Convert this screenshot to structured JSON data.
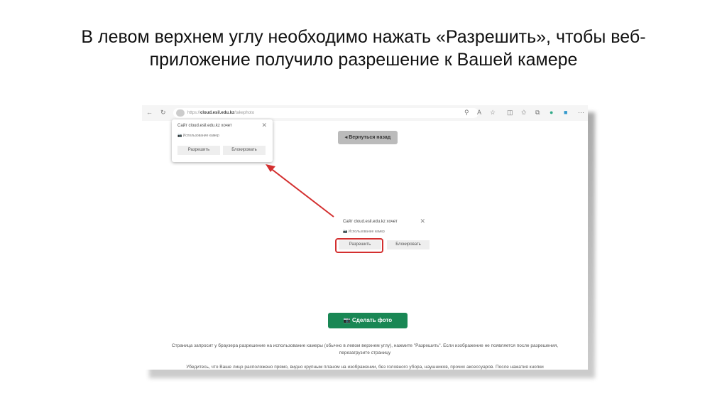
{
  "slide": {
    "title_line1": "В левом верхнем углу необходимо нажать «Разрешить», чтобы веб-",
    "title_line2": "приложение получило разрешение к Вашей камере"
  },
  "browser": {
    "url_prefix": "https://",
    "url_host": "cloud.esil.edu.kz",
    "url_path": "/takephoto"
  },
  "permission_popup": {
    "title": "Сайт cloud.esil.edu.kz хочет",
    "capability": "Использование камер",
    "allow": "Разрешить",
    "block": "Блокировать",
    "close": "✕"
  },
  "page": {
    "back_button": "Вернуться назад",
    "photo_button": "Сделать фото",
    "note1": "Страница запросит у браузера разрешение на использование камеры (обычно в левом верхнем углу), нажмите \"Разрешить\". Если изображение не появляется после разрешения, перезагрузите страницу",
    "note2": "Убедитесь, что Ваше лицо расположено прямо, видно крупным планом на изображении, без головного убора, наушников, прочих аксессуаров. После нажатия кнопки"
  },
  "colors": {
    "accent_green": "#198754",
    "highlight_red": "#d32f2f"
  }
}
